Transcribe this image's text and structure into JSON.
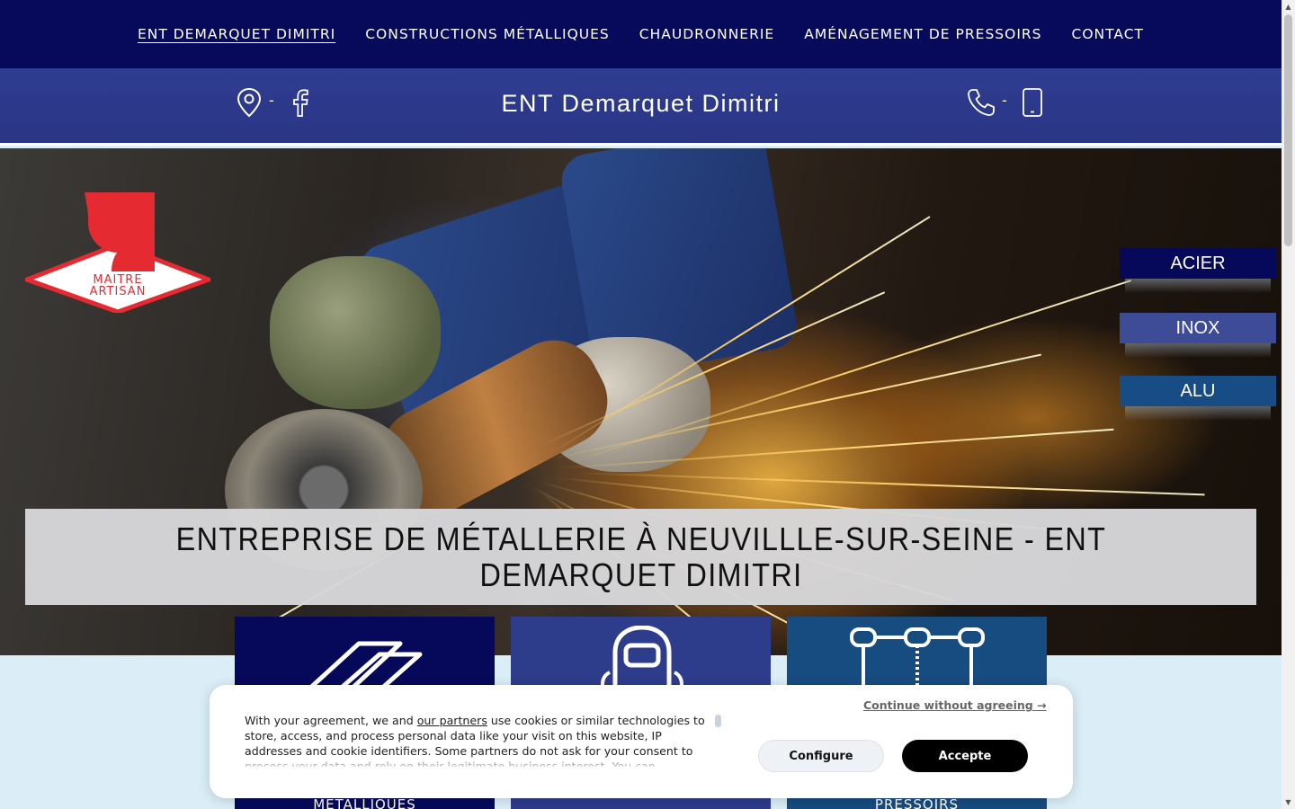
{
  "nav": {
    "items": [
      {
        "label": "ENT DEMARQUET DIMITRI",
        "active": true
      },
      {
        "label": "CONSTRUCTIONS MÉTALLIQUES",
        "active": false
      },
      {
        "label": "CHAUDRONNERIE",
        "active": false
      },
      {
        "label": "AMÉNAGEMENT DE PRESSOIRS",
        "active": false
      },
      {
        "label": "CONTACT",
        "active": false
      }
    ]
  },
  "header": {
    "title": "ENT Demarquet Dimitri",
    "left_icons": [
      "map-pin-icon",
      "facebook-icon"
    ],
    "right_icons": [
      "phone-icon",
      "mobile-icon"
    ],
    "separator": "-"
  },
  "hero": {
    "logo_text_line1": "MAITRE",
    "logo_text_line2": "ARTISAN",
    "side_buttons": [
      {
        "label": "ACIER",
        "color": "#06095a"
      },
      {
        "label": "INOX",
        "color": "#3e4c98"
      },
      {
        "label": "ALU",
        "color": "#174c85"
      }
    ],
    "headline": "ENTREPRISE DE MÉTALLERIE À NEUVILLLE-SUR-SEINE - ENT DEMARQUET DIMITRI"
  },
  "cards": [
    {
      "label": "MÉTALLIQUES",
      "color": "#06095a",
      "icon": "metal-beams-icon"
    },
    {
      "label": "",
      "color": "#2e3c8c",
      "icon": "welding-mask-icon"
    },
    {
      "label": "PRESSOIRS",
      "color": "#174c80",
      "icon": "press-frame-icon"
    }
  ],
  "cookie": {
    "text_before_link": "With your agreement, we and ",
    "link": "our partners",
    "text_after_link": " use cookies or similar technologies to store, access, and process personal data like your visit on this website, IP addresses and cookie identifiers. Some partners do not ask for your consent to process your data and rely on their legitimate business interest. You can",
    "continue_label": "Continue without agreeing →",
    "configure_label": "Configure",
    "accept_label": "Accepte"
  },
  "colors": {
    "nav_bg": "#070a5a",
    "header_bg": "#2f3d91",
    "accept_bg": "#000000"
  }
}
